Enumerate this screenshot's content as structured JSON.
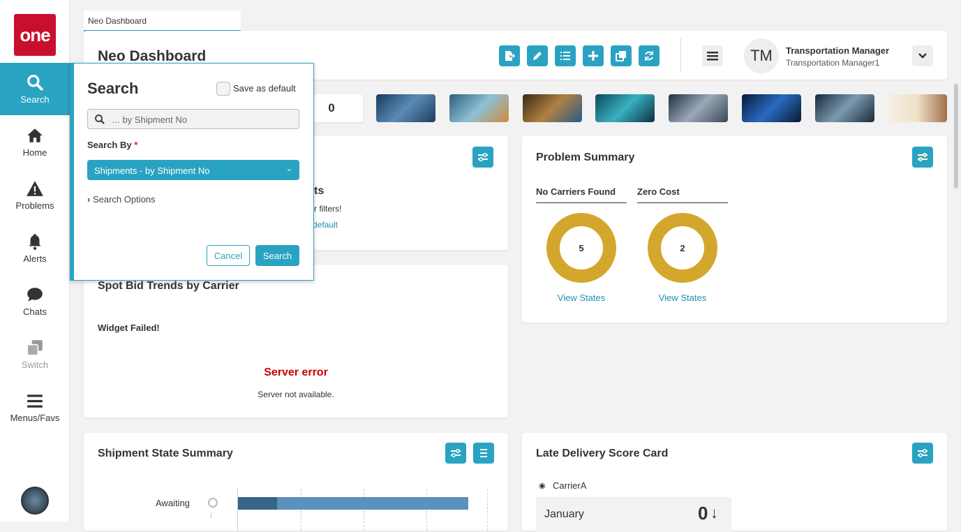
{
  "logo": "one",
  "sidebar": {
    "items": [
      {
        "label": "Search"
      },
      {
        "label": "Home"
      },
      {
        "label": "Problems"
      },
      {
        "label": "Alerts"
      },
      {
        "label": "Chats"
      },
      {
        "label": "Switch"
      },
      {
        "label": "Menus/Favs"
      }
    ]
  },
  "tab": {
    "label": "Neo Dashboard"
  },
  "header": {
    "title": "Neo Dashboard",
    "user_initials": "TM",
    "user_role": "Transportation Manager",
    "user_name": "Transportation Manager1"
  },
  "counter_tile": {
    "value": "0"
  },
  "search_popup": {
    "title": "Search",
    "save_default": "Save as default",
    "placeholder": "... by Shipment No",
    "search_by_label": "Search By",
    "required": "*",
    "select_value": "Shipments - by Shipment No",
    "options_label": "Search Options",
    "cancel": "Cancel",
    "search": "Search"
  },
  "hidden_widget": {
    "frag1": "ts",
    "frag2": "r filters!",
    "frag3": "default"
  },
  "spot_bid": {
    "title": "Spot Bid Trends by Carrier",
    "failed": "Widget Failed!",
    "error": "Server error",
    "error_msg": "Server not available."
  },
  "problem_summary": {
    "title": "Problem Summary",
    "items": [
      {
        "label": "No Carriers Found",
        "value": "5",
        "link": "View States"
      },
      {
        "label": "Zero Cost",
        "value": "2",
        "link": "View States"
      }
    ]
  },
  "shipment_state": {
    "title": "Shipment State Summary",
    "row_label": "Awaiting",
    "segments": [
      {
        "value": 17,
        "color": "#35658a"
      },
      {
        "value": 83,
        "color": "#5a91bd"
      }
    ]
  },
  "late_delivery": {
    "title": "Late Delivery Score Card",
    "carrier": "CarrierA",
    "month": "January",
    "score": "0"
  }
}
